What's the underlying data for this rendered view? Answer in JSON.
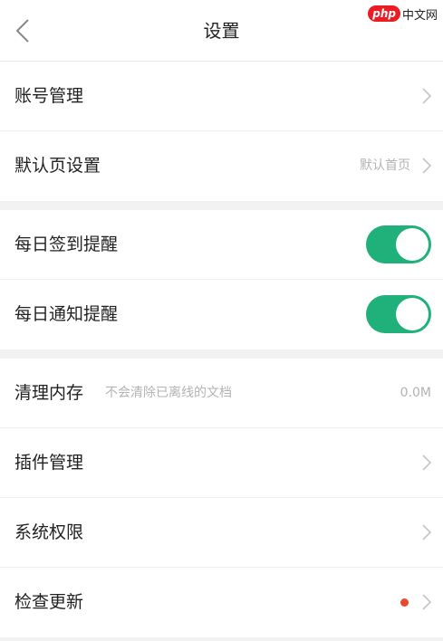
{
  "header": {
    "title": "设置",
    "back_icon": "chevron-left-icon",
    "watermark": {
      "logo": "php",
      "text": "中文网"
    }
  },
  "groups": [
    {
      "rows": [
        {
          "label": "账号管理",
          "chevron": true
        },
        {
          "label": "默认页设置",
          "value": "默认首页",
          "chevron": true
        }
      ]
    },
    {
      "rows": [
        {
          "label": "每日签到提醒",
          "toggle_on": true
        },
        {
          "label": "每日通知提醒",
          "toggle_on": true
        }
      ]
    },
    {
      "rows": [
        {
          "label": "清理内存",
          "hint": "不会清除已离线的文档",
          "value": "0.0M"
        },
        {
          "label": "插件管理",
          "chevron": true
        },
        {
          "label": "系统权限",
          "chevron": true
        },
        {
          "label": "检查更新",
          "badge_dot": true,
          "chevron": true
        }
      ]
    }
  ],
  "colors": {
    "toggle_on": "#1fb179",
    "badge_dot": "#e8492d",
    "background": "#f2f2f2",
    "hint_text": "#b3b3b3"
  }
}
